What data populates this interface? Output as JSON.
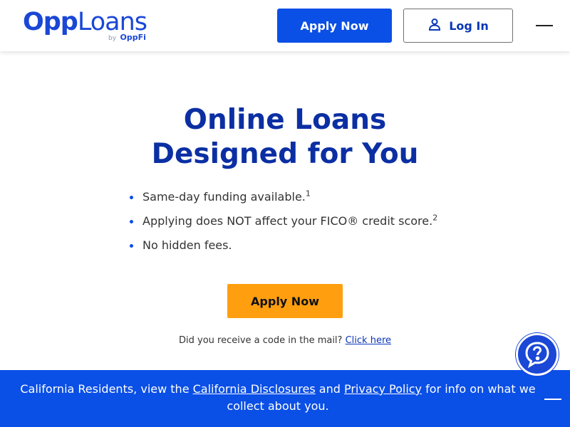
{
  "header": {
    "logo": {
      "part1": "Opp",
      "part2": "Loans",
      "by": "by",
      "brand": "OppFi"
    },
    "apply_label": "Apply Now",
    "login_label": "Log In"
  },
  "hero": {
    "title_line1": "Online Loans",
    "title_line2": "Designed for You",
    "features": [
      {
        "text": "Same-day funding available.",
        "sup": "1"
      },
      {
        "text": "Applying does NOT affect your FICO® credit score.",
        "sup": "2"
      },
      {
        "text": "No hidden fees.",
        "sup": ""
      }
    ],
    "apply_label": "Apply Now",
    "mail_prompt": "Did you receive a code in the mail?",
    "mail_link": "Click here"
  },
  "banner": {
    "prefix": "California Residents, view the ",
    "link1": "California Disclosures",
    "middle": " and ",
    "link2": "Privacy Policy",
    "suffix": " for info on what we collect about you."
  },
  "colors": {
    "brand_blue": "#0a4fe6",
    "heading_blue": "#0b2fa3",
    "cta_orange": "#ff9f0f"
  },
  "icons": {
    "login": "user-icon",
    "menu": "hamburger-icon",
    "help": "question-bubble-icon",
    "close": "minimize-icon"
  }
}
